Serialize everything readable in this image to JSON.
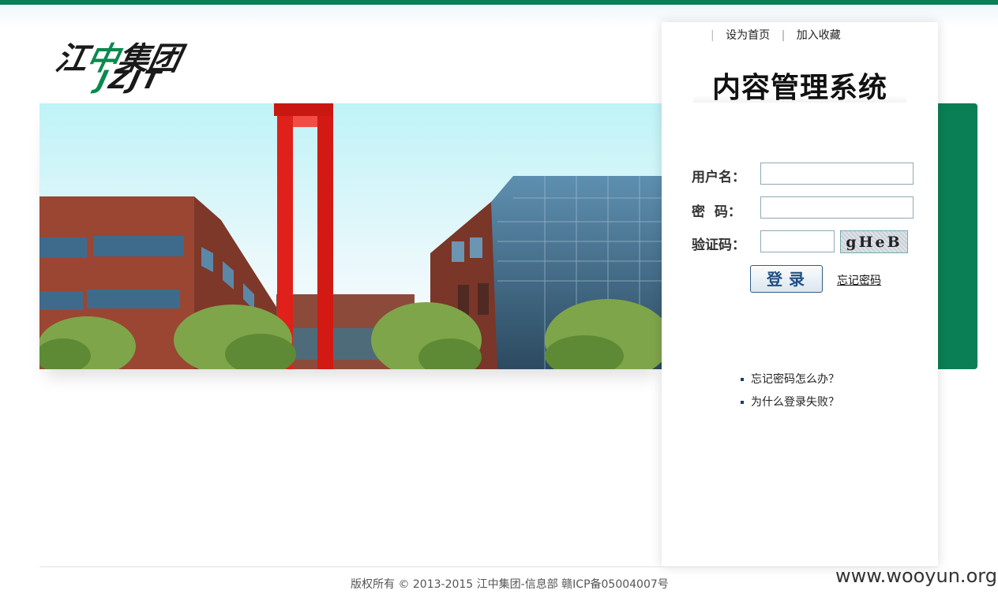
{
  "header": {
    "logo_cn": "江中集团",
    "logo_en": "JZJT",
    "links": [
      "设为首页",
      "加入收藏"
    ]
  },
  "system_title": "内容管理系统",
  "form": {
    "username_label": "用户名：",
    "username_value": "",
    "password_label": "密  码：",
    "password_value": "",
    "captcha_label": "验证码：",
    "captcha_value": "",
    "captcha_text": "gHeB",
    "login_label": "登录",
    "forgot_label": "忘记密码"
  },
  "help": {
    "items": [
      "忘记密码怎么办？",
      "为什么登录失败？"
    ]
  },
  "footer": {
    "copyright": "版权所有 © 2013-2015 江中集团-信息部 赣ICP备05004007号"
  },
  "watermark": "www.wooyun.org",
  "colors": {
    "brand_green": "#0a7f55",
    "button_text": "#1f4f84"
  }
}
